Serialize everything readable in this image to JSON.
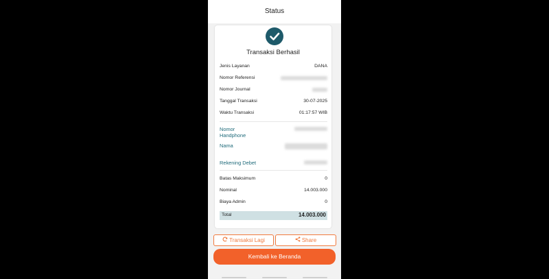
{
  "header": {
    "title": "Status"
  },
  "card": {
    "title": "Transaksi Berhasil",
    "rows_top": [
      {
        "label": "Jenis Layanan",
        "value": "DANA"
      },
      {
        "label": "Nomor Referensi",
        "value": ""
      },
      {
        "label": "Nomor Journal",
        "value": ""
      },
      {
        "label": "Tanggal Transaksi",
        "value": "30-07-2025"
      },
      {
        "label": "Waktu Transaksi",
        "value": "01:17:57 WIB"
      }
    ],
    "rows_mid": [
      {
        "label": "Nomor Handphone"
      },
      {
        "label": "Nama"
      },
      {
        "label": "Rekening Debet"
      }
    ],
    "rows_bottom": [
      {
        "label": "Batas Maksimum",
        "value": "0"
      },
      {
        "label": "Nominal",
        "value": "14.003.000"
      },
      {
        "label": "Biaya Admin",
        "value": "0"
      }
    ],
    "total": {
      "label": "Total",
      "value": "14.003.000"
    }
  },
  "actions": {
    "repeat_label": "Transaksi Lagi",
    "share_label": "Share",
    "home_label": "Kembali ke Beranda"
  },
  "colors": {
    "accent": "#f2612a",
    "teal": "#1e5a6a",
    "total_bg": "#cfe0e3"
  },
  "icons": {
    "success": "check-circle-icon",
    "repeat": "refresh-icon",
    "share": "share-icon"
  }
}
